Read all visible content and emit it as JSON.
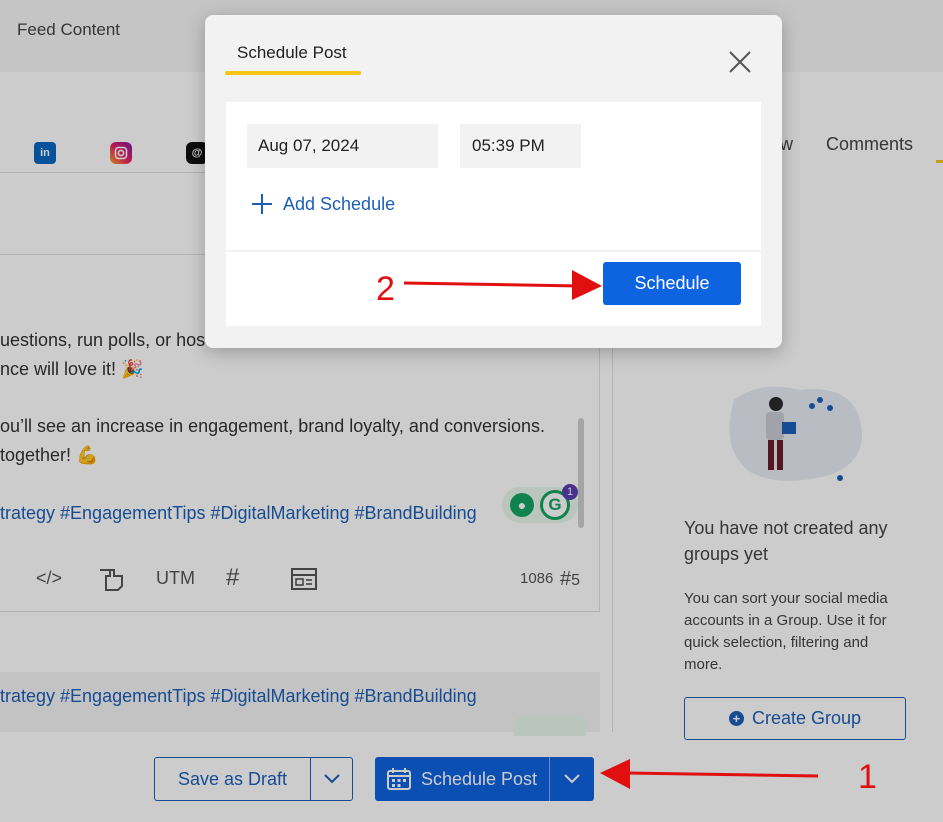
{
  "header": {
    "title": "Feed Content"
  },
  "networks": [
    "linkedin-icon",
    "instagram-icon",
    "threads-icon"
  ],
  "tabs": {
    "partial": "w",
    "comments": "Comments"
  },
  "post": {
    "line1": "uestions, run polls, or hos",
    "line2": "nce will love it! 🎉",
    "line3": "ou’ll see an increase in engagement, brand loyalty, and conversions.",
    "line4": " together! 💪",
    "hashtags": "trategy #EngagementTips #DigitalMarketing #BrandBuilding",
    "preview_hashtags": "trategy #EngagementTips #DigitalMarketing #BrandBuilding",
    "grammarly_badge": "1"
  },
  "toolbar": {
    "code": "</>",
    "utm": "UTM",
    "hash": "#",
    "char_count": "1086",
    "hash_count": "5"
  },
  "sidebar": {
    "empty_title": "You have not created any groups yet",
    "empty_desc": "You can sort your social media accounts in a Group. Use it for quick selection, filtering and more.",
    "create_group": "Create Group"
  },
  "bottom": {
    "save_draft": "Save as Draft",
    "schedule_post": "Schedule Post"
  },
  "modal": {
    "tab": "Schedule Post",
    "date": "Aug 07, 2024",
    "time": "05:39 PM",
    "add_schedule": "Add Schedule",
    "schedule_button": "Schedule"
  },
  "annotations": {
    "step1": "1",
    "step2": "2"
  },
  "colors": {
    "primary": "#0e63e0",
    "accent_yellow": "#f5c518",
    "link_blue": "#1d5fb8",
    "arrow_red": "#e01010"
  }
}
